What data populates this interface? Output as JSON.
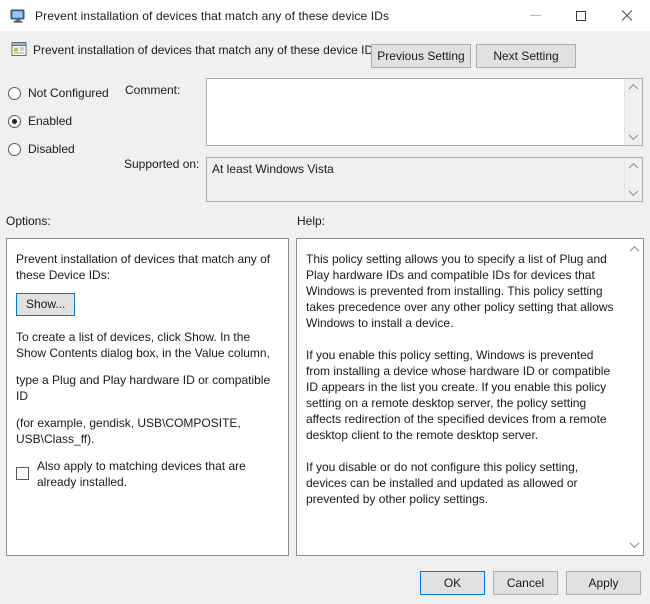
{
  "window": {
    "title": "Prevent installation of devices that match any of these device IDs",
    "icon": "computer-monitor-icon",
    "controls": {
      "minimize": "minimize-icon",
      "maximize": "maximize-icon",
      "close": "close-icon"
    }
  },
  "header": {
    "icon": "policy-setting-icon",
    "title": "Prevent installation of devices that match any of these device IDs",
    "previous_setting": "Previous Setting",
    "next_setting": "Next Setting"
  },
  "state": {
    "options": [
      {
        "label": "Not Configured",
        "selected": false
      },
      {
        "label": "Enabled",
        "selected": true
      },
      {
        "label": "Disabled",
        "selected": false
      }
    ]
  },
  "comment": {
    "label": "Comment:",
    "value": "",
    "placeholder": ""
  },
  "supported_on": {
    "label": "Supported on:",
    "value": "At least Windows Vista"
  },
  "options_panel": {
    "section_label": "Options:",
    "heading": "Prevent installation of devices that match any of these Device IDs:",
    "show_button": "Show...",
    "paragraphs": [
      "To create a list of devices, click Show. In the Show Contents dialog box, in the Value column,",
      "type a Plug and Play hardware ID or compatible ID",
      "(for example, gendisk, USB\\COMPOSITE, USB\\Class_ff)."
    ],
    "checkbox": {
      "label": "Also apply to matching devices that are already installed.",
      "checked": false
    }
  },
  "help_panel": {
    "section_label": "Help:",
    "paragraphs": [
      "This policy setting allows you to specify a list of Plug and Play hardware IDs and compatible IDs for devices that Windows is prevented from installing. This policy setting takes precedence over any other policy setting that allows Windows to install a device.",
      "If you enable this policy setting, Windows is prevented from installing a device whose hardware ID or compatible ID appears in the list you create. If you enable this policy setting on a remote desktop server, the policy setting affects redirection of the specified devices from a remote desktop client to the remote desktop server.",
      "If you disable or do not configure this policy setting, devices can be installed and updated as allowed or prevented by other policy settings."
    ]
  },
  "footer": {
    "ok": "OK",
    "cancel": "Cancel",
    "apply": "Apply"
  },
  "colors": {
    "accent": "#0078d7",
    "dialog_bg": "#f0f0f0",
    "panel_bg": "#ffffff",
    "button_bg": "#e1e1e1",
    "border": "#adadad",
    "text": "#1a1a1a"
  }
}
